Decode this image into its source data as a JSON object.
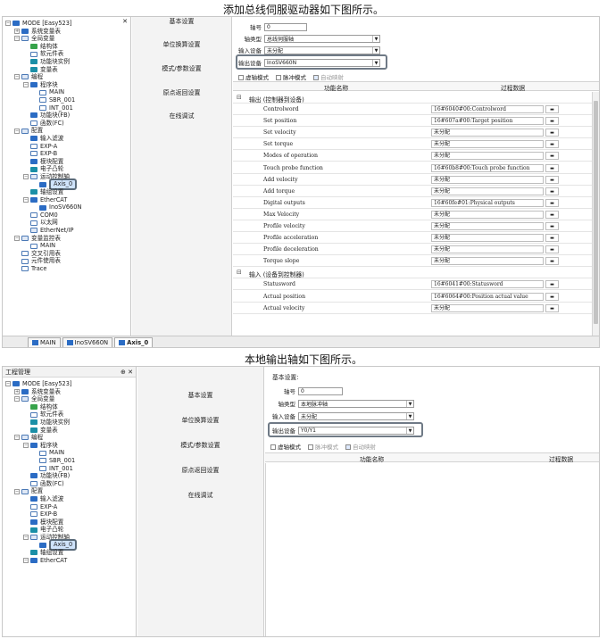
{
  "caption1": "添加总线伺服驱动器如下图所示。",
  "caption2": "本地输出轴如下图所示。",
  "tree1": [
    {
      "t": "MODE [Easy523]",
      "lv": 0,
      "ic": "blue",
      "tw": "−"
    },
    {
      "t": "系统变量表",
      "lv": 1,
      "ic": "blue",
      "tw": "+"
    },
    {
      "t": "全局变量",
      "lv": 1,
      "ic": "grid",
      "tw": "−"
    },
    {
      "t": "结构体",
      "lv": 2,
      "ic": "green"
    },
    {
      "t": "软元件表",
      "lv": 2,
      "ic": "doc"
    },
    {
      "t": "功能块实例",
      "lv": 2,
      "ic": "teal"
    },
    {
      "t": "变量表",
      "lv": 2,
      "ic": "teal"
    },
    {
      "t": "编程",
      "lv": 1,
      "ic": "grid",
      "tw": "−"
    },
    {
      "t": "程序块",
      "lv": 2,
      "ic": "blue",
      "tw": "−"
    },
    {
      "t": "MAIN",
      "lv": 3,
      "ic": "doc"
    },
    {
      "t": "SBR_001",
      "lv": 3,
      "ic": "doc"
    },
    {
      "t": "INT_001",
      "lv": 3,
      "ic": "doc"
    },
    {
      "t": "功能块(FB)",
      "lv": 2,
      "ic": "blue"
    },
    {
      "t": "函数(FC)",
      "lv": 2,
      "ic": "doc"
    },
    {
      "t": "配置",
      "lv": 1,
      "ic": "grid",
      "tw": "−"
    },
    {
      "t": "输入滤波",
      "lv": 2,
      "ic": "blue"
    },
    {
      "t": "EXP-A",
      "lv": 2,
      "ic": "doc"
    },
    {
      "t": "EXP-B",
      "lv": 2,
      "ic": "doc"
    },
    {
      "t": "模块配置",
      "lv": 2,
      "ic": "blue"
    },
    {
      "t": "电子凸轮",
      "lv": 2,
      "ic": "teal"
    },
    {
      "t": "运动控制轴",
      "lv": 2,
      "ic": "grid",
      "tw": "−"
    },
    {
      "t": "Axis_0",
      "lv": 3,
      "ic": "blue",
      "sel": true
    },
    {
      "t": "轴组设置",
      "lv": 2,
      "ic": "teal"
    },
    {
      "t": "EtherCAT",
      "lv": 2,
      "ic": "blue",
      "tw": "−"
    },
    {
      "t": "InoSV660N",
      "lv": 3,
      "ic": "blue"
    },
    {
      "t": "COM0",
      "lv": 2,
      "ic": "doc"
    },
    {
      "t": "以太网",
      "lv": 2,
      "ic": "doc"
    },
    {
      "t": "EtherNet/IP",
      "lv": 2,
      "ic": "grid"
    },
    {
      "t": "变量监控表",
      "lv": 1,
      "ic": "grid",
      "tw": "−"
    },
    {
      "t": "MAIN",
      "lv": 2,
      "ic": "doc"
    },
    {
      "t": "交叉引用表",
      "lv": 1,
      "ic": "doc"
    },
    {
      "t": "元件使用表",
      "lv": 1,
      "ic": "doc"
    },
    {
      "t": "Trace",
      "lv": 1,
      "ic": "doc"
    }
  ],
  "tree2": [
    {
      "t": "MODE [Easy523]",
      "lv": 0,
      "ic": "blue",
      "tw": "−"
    },
    {
      "t": "系统变量表",
      "lv": 1,
      "ic": "blue",
      "tw": "+"
    },
    {
      "t": "全局变量",
      "lv": 1,
      "ic": "grid",
      "tw": "−"
    },
    {
      "t": "结构体",
      "lv": 2,
      "ic": "green"
    },
    {
      "t": "软元件表",
      "lv": 2,
      "ic": "doc"
    },
    {
      "t": "功能块实例",
      "lv": 2,
      "ic": "teal"
    },
    {
      "t": "变量表",
      "lv": 2,
      "ic": "teal"
    },
    {
      "t": "编程",
      "lv": 1,
      "ic": "grid",
      "tw": "−"
    },
    {
      "t": "程序块",
      "lv": 2,
      "ic": "blue",
      "tw": "−"
    },
    {
      "t": "MAIN",
      "lv": 3,
      "ic": "doc"
    },
    {
      "t": "SBR_001",
      "lv": 3,
      "ic": "doc"
    },
    {
      "t": "INT_001",
      "lv": 3,
      "ic": "doc"
    },
    {
      "t": "功能块(FB)",
      "lv": 2,
      "ic": "blue"
    },
    {
      "t": "函数(FC)",
      "lv": 2,
      "ic": "doc"
    },
    {
      "t": "配置",
      "lv": 1,
      "ic": "grid",
      "tw": "−"
    },
    {
      "t": "输入滤波",
      "lv": 2,
      "ic": "blue"
    },
    {
      "t": "EXP-A",
      "lv": 2,
      "ic": "doc"
    },
    {
      "t": "EXP-B",
      "lv": 2,
      "ic": "doc"
    },
    {
      "t": "模块配置",
      "lv": 2,
      "ic": "blue"
    },
    {
      "t": "电子凸轮",
      "lv": 2,
      "ic": "teal"
    },
    {
      "t": "运动控制轴",
      "lv": 2,
      "ic": "grid",
      "tw": "−"
    },
    {
      "t": "Axis_0",
      "lv": 3,
      "ic": "blue",
      "sel": true
    },
    {
      "t": "轴组设置",
      "lv": 2,
      "ic": "teal"
    },
    {
      "t": "EtherCAT",
      "lv": 2,
      "ic": "blue",
      "tw": "−"
    }
  ],
  "panel2_title": "工程管理",
  "panel2_pin": "⊕ ✕",
  "menu": [
    "基本设置",
    "单位换算设置",
    "模式/参数设置",
    "原点返回设置",
    "在线调试"
  ],
  "form1": {
    "axis_no_label": "轴号",
    "axis_no": "0",
    "axis_type_label": "轴类型",
    "axis_type": "总线伺服轴",
    "input_dev_label": "输入设备",
    "input_dev": "未分配",
    "output_dev_label": "输出设备",
    "output_dev": "InoSV660N",
    "cb_virtual": "虚轴模式",
    "cb_pulse": "脉冲模式",
    "cb_auto": "自动映射",
    "col_name": "功能名称",
    "col_data": "过程数据"
  },
  "form2": {
    "section": "基本设置:",
    "axis_no_label": "轴号",
    "axis_no": "0",
    "axis_type_label": "轴类型",
    "axis_type": "本地脉冲轴",
    "input_dev_label": "输入设备",
    "input_dev": "未分配",
    "output_dev_label": "输出设备",
    "output_dev": "Y0/Y1",
    "cb_virtual": "虚轴模式",
    "cb_pulse": "脉冲模式",
    "cb_auto": "自动映射",
    "col_name": "功能名称",
    "col_data": "过程数据"
  },
  "group_out": "输出 (控制器到设备)",
  "group_in": "输入 (设备到控制器)",
  "outputs": [
    {
      "n": "Controlword",
      "v": "16#6040#00:Controlword"
    },
    {
      "n": "Set position",
      "v": "16#607a#00:Target position"
    },
    {
      "n": "Set velocity",
      "v": "未分配"
    },
    {
      "n": "Set torque",
      "v": "未分配"
    },
    {
      "n": "Modes of operation",
      "v": "未分配"
    },
    {
      "n": "Touch probe function",
      "v": "16#60b8#00:Touch probe function"
    },
    {
      "n": "Add velocity",
      "v": "未分配"
    },
    {
      "n": "Add torque",
      "v": "未分配"
    },
    {
      "n": "Digital outputs",
      "v": "16#60fe#01:Physical outputs"
    },
    {
      "n": "Max Velocity",
      "v": "未分配"
    },
    {
      "n": "Profile velocity",
      "v": "未分配"
    },
    {
      "n": "Profile acceleration",
      "v": "未分配"
    },
    {
      "n": "Profile deceleration",
      "v": "未分配"
    },
    {
      "n": "Torque slope",
      "v": "未分配"
    }
  ],
  "inputs": [
    {
      "n": "Statusword",
      "v": "16#6041#00:Statusword"
    },
    {
      "n": "Actual position",
      "v": "16#6064#00:Position actual value"
    },
    {
      "n": "Actual velocity",
      "v": "未分配"
    }
  ],
  "tabs": [
    "MAIN",
    "InoSV660N",
    "Axis_0"
  ]
}
